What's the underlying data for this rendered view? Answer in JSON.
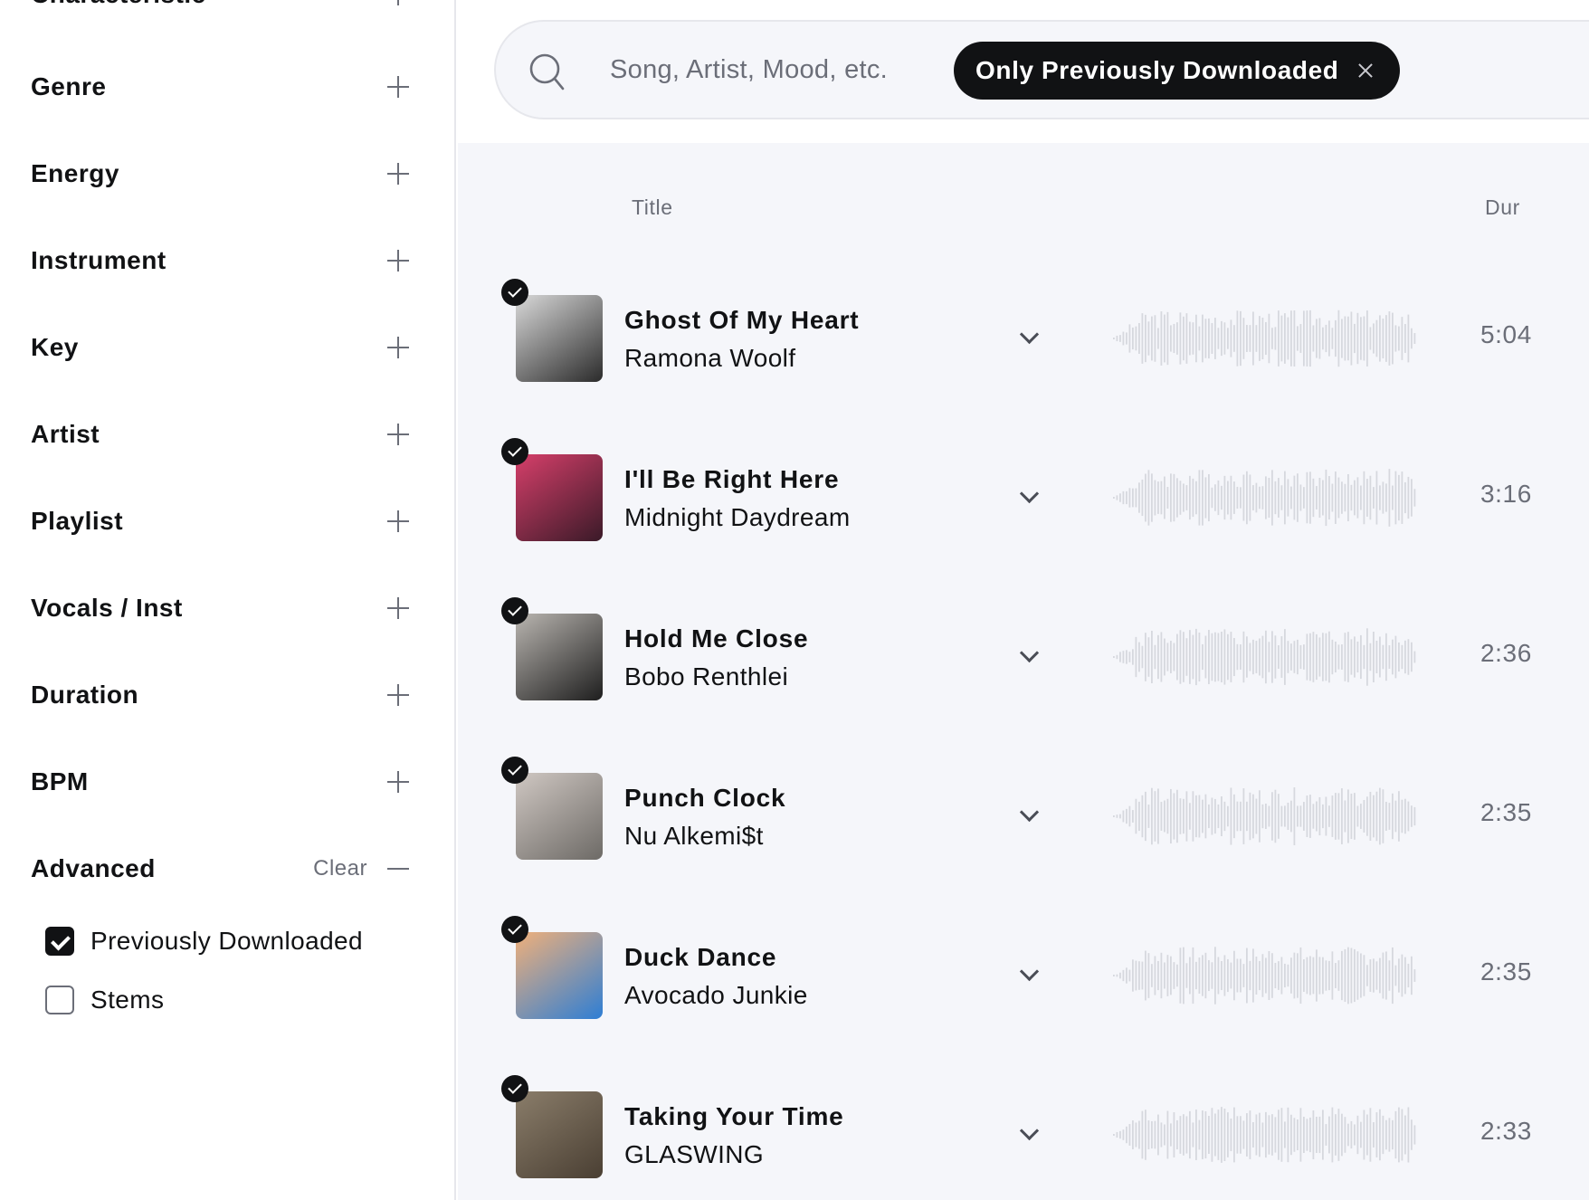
{
  "sidebar": {
    "filters": [
      {
        "label": "Characteristic",
        "state": "collapsed"
      },
      {
        "label": "Genre",
        "state": "collapsed"
      },
      {
        "label": "Energy",
        "state": "collapsed"
      },
      {
        "label": "Instrument",
        "state": "collapsed"
      },
      {
        "label": "Key",
        "state": "collapsed"
      },
      {
        "label": "Artist",
        "state": "collapsed"
      },
      {
        "label": "Playlist",
        "state": "collapsed"
      },
      {
        "label": "Vocals / Inst",
        "state": "collapsed"
      },
      {
        "label": "Duration",
        "state": "collapsed"
      },
      {
        "label": "BPM",
        "state": "collapsed"
      }
    ],
    "advanced": {
      "label": "Advanced",
      "clear_label": "Clear",
      "state": "expanded",
      "options": [
        {
          "label": "Previously Downloaded",
          "checked": true
        },
        {
          "label": "Stems",
          "checked": false
        }
      ]
    }
  },
  "search": {
    "placeholder": "Song, Artist, Mood, etc.",
    "active_chip": "Only Previously Downloaded"
  },
  "table": {
    "headers": {
      "title": "Title",
      "duration": "Dur"
    },
    "tracks": [
      {
        "title": "Ghost Of My Heart",
        "artist": "Ramona Woolf",
        "duration": "5:04",
        "downloaded": true,
        "art_colors": [
          "#2b2b2b",
          "#d9d9d9"
        ]
      },
      {
        "title": "I'll Be Right Here",
        "artist": "Midnight Daydream",
        "duration": "3:16",
        "downloaded": true,
        "art_colors": [
          "#3a1a28",
          "#d63f6a"
        ]
      },
      {
        "title": "Hold Me Close",
        "artist": "Bobo Renthlei",
        "duration": "2:36",
        "downloaded": true,
        "art_colors": [
          "#1e1e1e",
          "#b9b5b0"
        ]
      },
      {
        "title": "Punch Clock",
        "artist": "Nu Alkemi$t",
        "duration": "2:35",
        "downloaded": true,
        "art_colors": [
          "#6d6a66",
          "#cfc7c2"
        ]
      },
      {
        "title": "Duck Dance",
        "artist": "Avocado Junkie",
        "duration": "2:35",
        "downloaded": true,
        "art_colors": [
          "#2e7ed4",
          "#f0b07a"
        ]
      },
      {
        "title": "Taking Your Time",
        "artist": "GLASWING",
        "duration": "2:33",
        "downloaded": true,
        "art_colors": [
          "#4a3f33",
          "#8a7d6a"
        ]
      }
    ]
  },
  "colors": {
    "accent": "#111214",
    "muted_text": "#6b6e78",
    "main_bg": "#f5f6fa",
    "waveform": "#d6d8de"
  }
}
